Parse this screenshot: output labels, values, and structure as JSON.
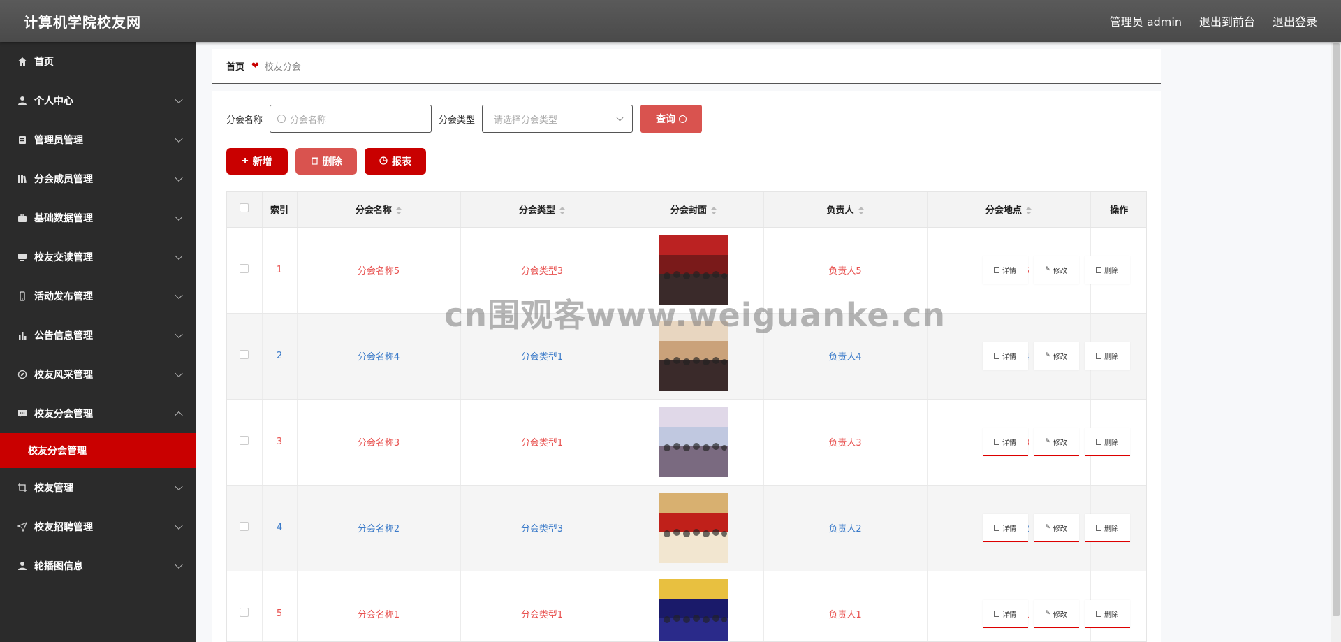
{
  "header": {
    "title": "计算机学院校友网",
    "user_label": "管理员 admin",
    "to_front": "退出到前台",
    "logout": "退出登录"
  },
  "sidebar": {
    "items": [
      {
        "label": "首页",
        "icon": "home-icon"
      },
      {
        "label": "个人中心",
        "icon": "user-icon"
      },
      {
        "label": "管理员管理",
        "icon": "clipboard-icon"
      },
      {
        "label": "分会成员管理",
        "icon": "books-icon"
      },
      {
        "label": "基础数据管理",
        "icon": "briefcase-icon"
      },
      {
        "label": "校友交读管理",
        "icon": "monitor-icon"
      },
      {
        "label": "活动发布管理",
        "icon": "phone-icon"
      },
      {
        "label": "公告信息管理",
        "icon": "bar-chart-icon"
      },
      {
        "label": "校友风采管理",
        "icon": "compass-icon"
      },
      {
        "label": "校友分会管理",
        "icon": "chat-icon"
      },
      {
        "label": "校友管理",
        "icon": "crop-icon"
      },
      {
        "label": "校友招聘管理",
        "icon": "send-icon"
      },
      {
        "label": "轮播图信息",
        "icon": "user-icon"
      }
    ],
    "active_sub": "校友分会管理"
  },
  "breadcrumb": {
    "home": "首页",
    "current": "校友分会"
  },
  "search": {
    "name_label": "分会名称",
    "name_placeholder": "分会名称",
    "type_label": "分会类型",
    "type_placeholder": "请选择分会类型",
    "query_button": "查询"
  },
  "actions": {
    "add": "新增",
    "delete": "删除",
    "report": "报表"
  },
  "table": {
    "headers": [
      "索引",
      "分会名称",
      "分会类型",
      "分会封面",
      "负责人",
      "分会地点",
      "操作"
    ],
    "rows": [
      {
        "index": "1",
        "name": "分会名称5",
        "type": "分会类型3",
        "leader": "负责人5",
        "place": "分会地点5"
      },
      {
        "index": "2",
        "name": "分会名称4",
        "type": "分会类型1",
        "leader": "负责人4",
        "place": "分会地点4"
      },
      {
        "index": "3",
        "name": "分会名称3",
        "type": "分会类型1",
        "leader": "负责人3",
        "place": "分会地点3"
      },
      {
        "index": "4",
        "name": "分会名称2",
        "type": "分会类型3",
        "leader": "负责人2",
        "place": "分会地点2"
      },
      {
        "index": "5",
        "name": "分会名称1",
        "type": "分会类型1",
        "leader": "负责人1",
        "place": "分会地点1"
      }
    ],
    "op_detail": "详情",
    "op_edit": "修改",
    "op_delete": "删除"
  },
  "watermark": "cn围观客www.weiguanke.cn",
  "colors": {
    "accent": "#c90000",
    "header_bg": "#4f4f4f",
    "sidebar_bg": "#2b2b2b",
    "row_red": "#e8514f",
    "row_blue": "#3a7ac9"
  }
}
